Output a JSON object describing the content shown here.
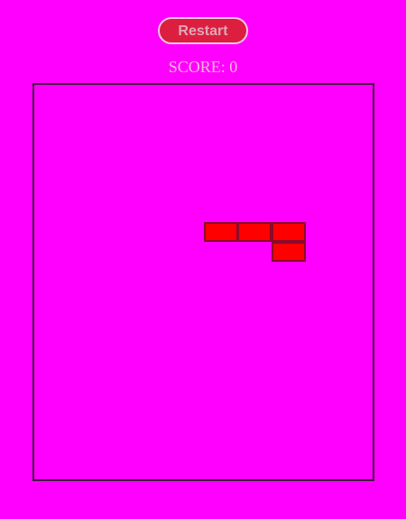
{
  "controls": {
    "restart_label": "Restart"
  },
  "score": {
    "label": "SCORE:",
    "value": "0",
    "display": "SCORE: 0"
  },
  "colors": {
    "background": "#ff00ff",
    "piece": "#ff0000",
    "board_border": "#3a1a3a",
    "button": "#dc1f3f"
  },
  "board": {
    "columns": 10,
    "active_piece": {
      "shape": "J",
      "cells": [
        {
          "col": 5,
          "row": 7
        },
        {
          "col": 6,
          "row": 7
        },
        {
          "col": 7,
          "row": 7
        },
        {
          "col": 7,
          "row": 8
        }
      ]
    }
  }
}
